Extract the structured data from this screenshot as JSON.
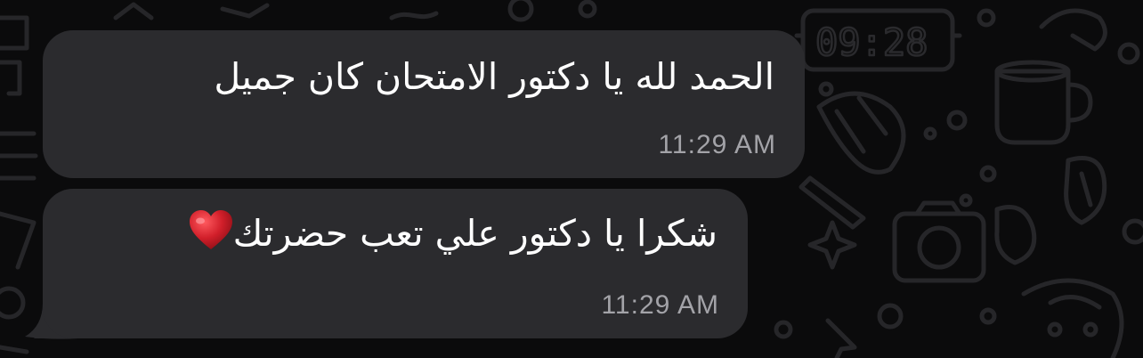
{
  "chat": {
    "messages": [
      {
        "text": "الحمد لله يا دكتور الامتحان كان جميل",
        "time": "11:29 AM"
      },
      {
        "text": "شكرا يا دكتور علي تعب حضرتك",
        "emoji": "heart",
        "time": "11:29 AM"
      }
    ],
    "wallpaper": {
      "clock_doodle": "09:28"
    }
  },
  "colors": {
    "background": "#0b0b0c",
    "bubble": "#2b2b2e",
    "text": "#ffffff",
    "timestamp": "#a3a3a8",
    "doodle": "#262629",
    "heart": "#d11f2a"
  }
}
